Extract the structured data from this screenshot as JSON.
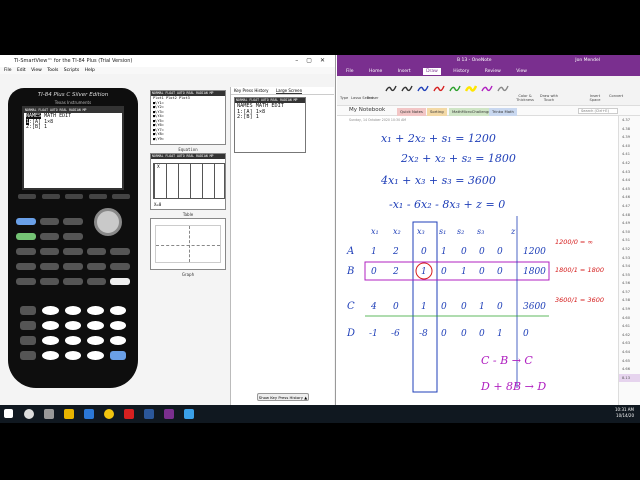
{
  "smartview": {
    "title": "TI-SmartView™ for the TI-84 Plus (Trial Version)",
    "menu": [
      "File",
      "Edit",
      "View",
      "Tools",
      "Scripts",
      "Help"
    ],
    "calculator": {
      "brand": "TI-84 Plus C Silver Edition",
      "maker": "Texas Instruments",
      "status_line": "NORMAL FLOAT AUTO REAL RADIAN MP",
      "screen_lines": [
        {
          "prefix": "NAMES",
          "text": " MATH EDIT"
        },
        {
          "prefix": "1",
          "text": ":[A] 1×8"
        },
        {
          "prefix": "",
          "text": "2:[B] 1"
        }
      ]
    },
    "panels": {
      "equation_caption": "Equation",
      "table_caption": "Table",
      "graph_caption": "Graph",
      "equation_header": "Plot1  Plot2  Plot3",
      "y_lines": [
        "■\\Y1=",
        "■\\Y2=",
        "■\\Y3=",
        "■\\Y4=",
        "■\\Y5=",
        "■\\Y6=",
        "■\\Y7=",
        "■\\Y8=",
        "■\\Y9="
      ],
      "table_head": [
        "X",
        "",
        "",
        ""
      ],
      "table_footer": "X=0"
    },
    "key_press": {
      "tabs": [
        "Key Press History",
        "Large Screen"
      ],
      "active_tab": "Large Screen",
      "screen_lines": [
        "NAMES MATH EDIT",
        "1:[A] 1×8",
        "2:[B] 1"
      ],
      "button": "Show Key Press History ▲"
    }
  },
  "onenote": {
    "title": "B 13 - OneNote",
    "user": "Jon Mendel",
    "menu": [
      "File",
      "Home",
      "Insert",
      "Draw",
      "History",
      "Review",
      "View"
    ],
    "active_menu": "Draw",
    "ribbon_labels": [
      "Type",
      "Lasso Select",
      "Eraser",
      "Color & Thickness",
      "Draw with Touch",
      "Insert Space",
      "Convert"
    ],
    "notebook": "My Notebook",
    "sections": [
      "Quick Notes",
      "Sorting",
      "MathMicroChallenges",
      "Trinka Math"
    ],
    "search_placeholder": "Search (Ctrl+E)",
    "page_stamp": "Sunday, 14 October 2020 10:30 AM",
    "equations": [
      "x₁ + 2x₂ + s₁ = 1200",
      "2x₂ + x₂ + s₂ = 1800",
      "4x₁ + x₃ + s₃ = 3600",
      "-x₁ - 6x₂ - 8x₃ + z = 0"
    ],
    "matrix_headers": [
      "x₁",
      "x₂",
      "x₃",
      "s₁",
      "s₂",
      "s₃",
      "z"
    ],
    "matrix_rows": [
      {
        "label": "A",
        "values": [
          "1",
          "2",
          "0",
          "1",
          "0",
          "0",
          "0",
          "1200"
        ]
      },
      {
        "label": "B",
        "values": [
          "0",
          "2",
          "1",
          "0",
          "1",
          "0",
          "0",
          "1800"
        ]
      },
      {
        "label": "C",
        "values": [
          "4",
          "0",
          "1",
          "0",
          "0",
          "1",
          "0",
          "3600"
        ]
      },
      {
        "label": "D",
        "values": [
          "-1",
          "-6",
          "-8",
          "0",
          "0",
          "0",
          "1",
          "0"
        ]
      }
    ],
    "ratios": [
      "1200/0 = ∞",
      "1800/1 = 1800",
      "3600/1 = 3600"
    ],
    "operations": [
      "C - B → C",
      "D + 8B → D"
    ],
    "page_list": [
      "4.37",
      "4.38",
      "4.39",
      "4.40",
      "4.41",
      "4.42",
      "4.43",
      "4.44",
      "4.45",
      "4.46",
      "4.47",
      "4.48",
      "4.49",
      "4.50",
      "4.51",
      "4.52",
      "4.53",
      "4.54",
      "4.55",
      "4.56",
      "4.57",
      "4.58",
      "4.59",
      "4.60",
      "4.61",
      "4.62",
      "4.63",
      "4.64",
      "4.65",
      "4.66",
      "8.13"
    ]
  },
  "taskbar": {
    "time": "10:31 AM",
    "date": "10/14/20"
  },
  "colors": {
    "onenote_purple": "#7a2f8f",
    "ink_blue": "#1f3fb8",
    "ink_red": "#d62020",
    "ink_purple": "#b020c0"
  }
}
